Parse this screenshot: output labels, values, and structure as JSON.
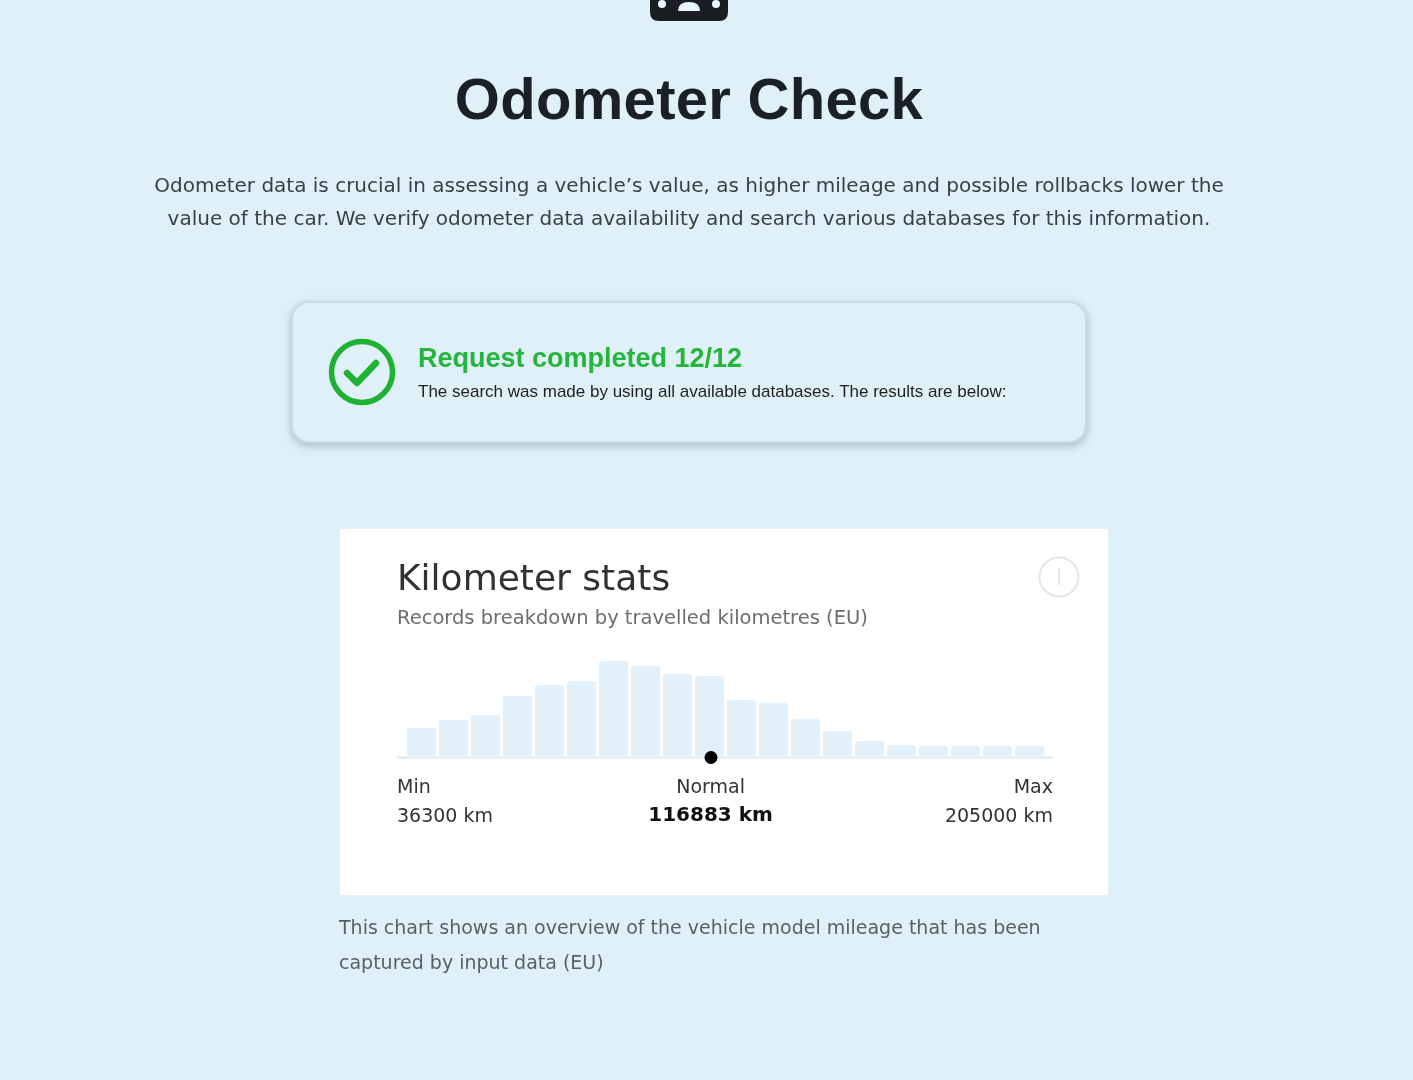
{
  "header": {
    "title": "Odometer Check",
    "description": "Odometer data is crucial in assessing a vehicle’s value, as higher mileage and possible rollbacks lower the value of the car. We verify odometer data availability and search various databases for this information."
  },
  "status": {
    "title": "Request completed 12/12",
    "message": "The search was made by using all available databases. The results are below:"
  },
  "kilometer_stats": {
    "title": "Kilometer stats",
    "subtitle": "Records breakdown by travelled kilometres (EU)",
    "range": {
      "level": 0.478
    },
    "stats": [
      {
        "kind": "min",
        "label": "Min",
        "value": "36300 km"
      },
      {
        "kind": "normal",
        "label": "Normal",
        "value": "116883 km"
      },
      {
        "kind": "max",
        "label": "Max",
        "value": "205000 km"
      }
    ],
    "caption": "This chart shows an overview of the vehicle model mileage that has been captured by input data (EU)"
  }
}
